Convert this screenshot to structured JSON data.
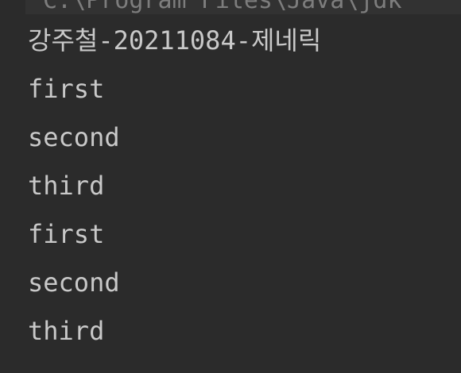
{
  "console": {
    "command": "C:\\Program Files\\Java\\jdk",
    "lines": [
      "강주철-20211084-제네릭",
      "first",
      "second",
      "third",
      "first",
      "second",
      "third"
    ]
  },
  "colors": {
    "background": "#2b2b2b",
    "text": "#c9c9c9",
    "command_text": "#7d7d7d"
  }
}
